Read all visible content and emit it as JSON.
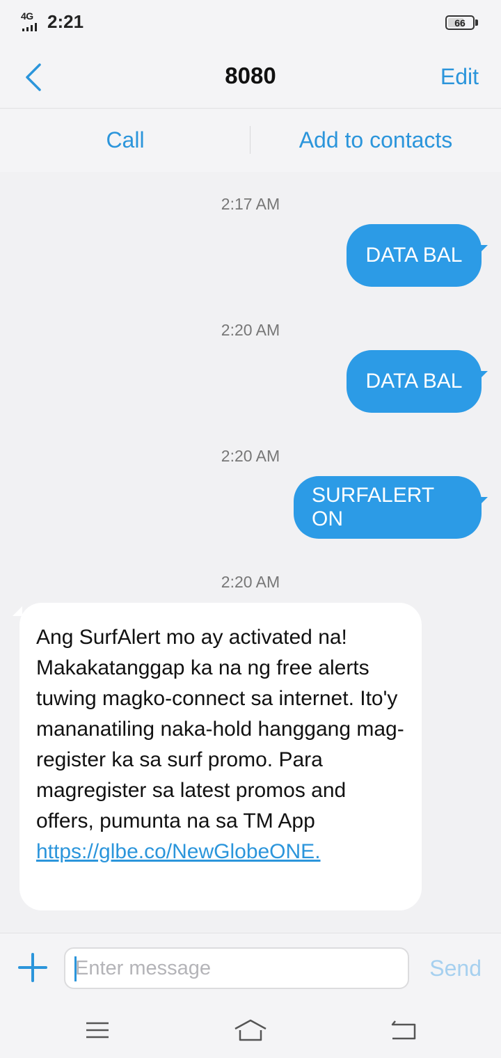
{
  "status_bar": {
    "network": "4G",
    "time": "2:21",
    "battery": 66
  },
  "header": {
    "title": "8080",
    "edit_label": "Edit"
  },
  "actions": {
    "call_label": "Call",
    "add_contact_label": "Add to contacts"
  },
  "messages": [
    {
      "timestamp": "2:17 AM",
      "direction": "outgoing",
      "text": "DATA BAL"
    },
    {
      "timestamp": "2:20 AM",
      "direction": "outgoing",
      "text": "DATA BAL"
    },
    {
      "timestamp": "2:20 AM",
      "direction": "outgoing",
      "text": "SURFALERT ON"
    },
    {
      "timestamp": "2:20 AM",
      "direction": "incoming",
      "text": "Ang SurfAlert mo ay activated na! Makakatanggap ka na ng free alerts tuwing magko-connect sa internet. Ito'y mananatiling naka-hold hanggang mag-register ka sa surf promo. Para magregister sa latest promos and offers, pumunta na sa TM App",
      "link": "https://glbe.co/NewGlobeONE."
    }
  ],
  "composer": {
    "placeholder": "Enter message",
    "send_label": "Send"
  },
  "colors": {
    "accent": "#2b95db",
    "outgoing_bubble": "#2c9be6",
    "background": "#f1f1f3"
  },
  "icons": [
    "signal-icon",
    "battery-icon",
    "back-chevron-icon",
    "plus-icon",
    "menu-icon",
    "home-icon",
    "back-icon"
  ]
}
